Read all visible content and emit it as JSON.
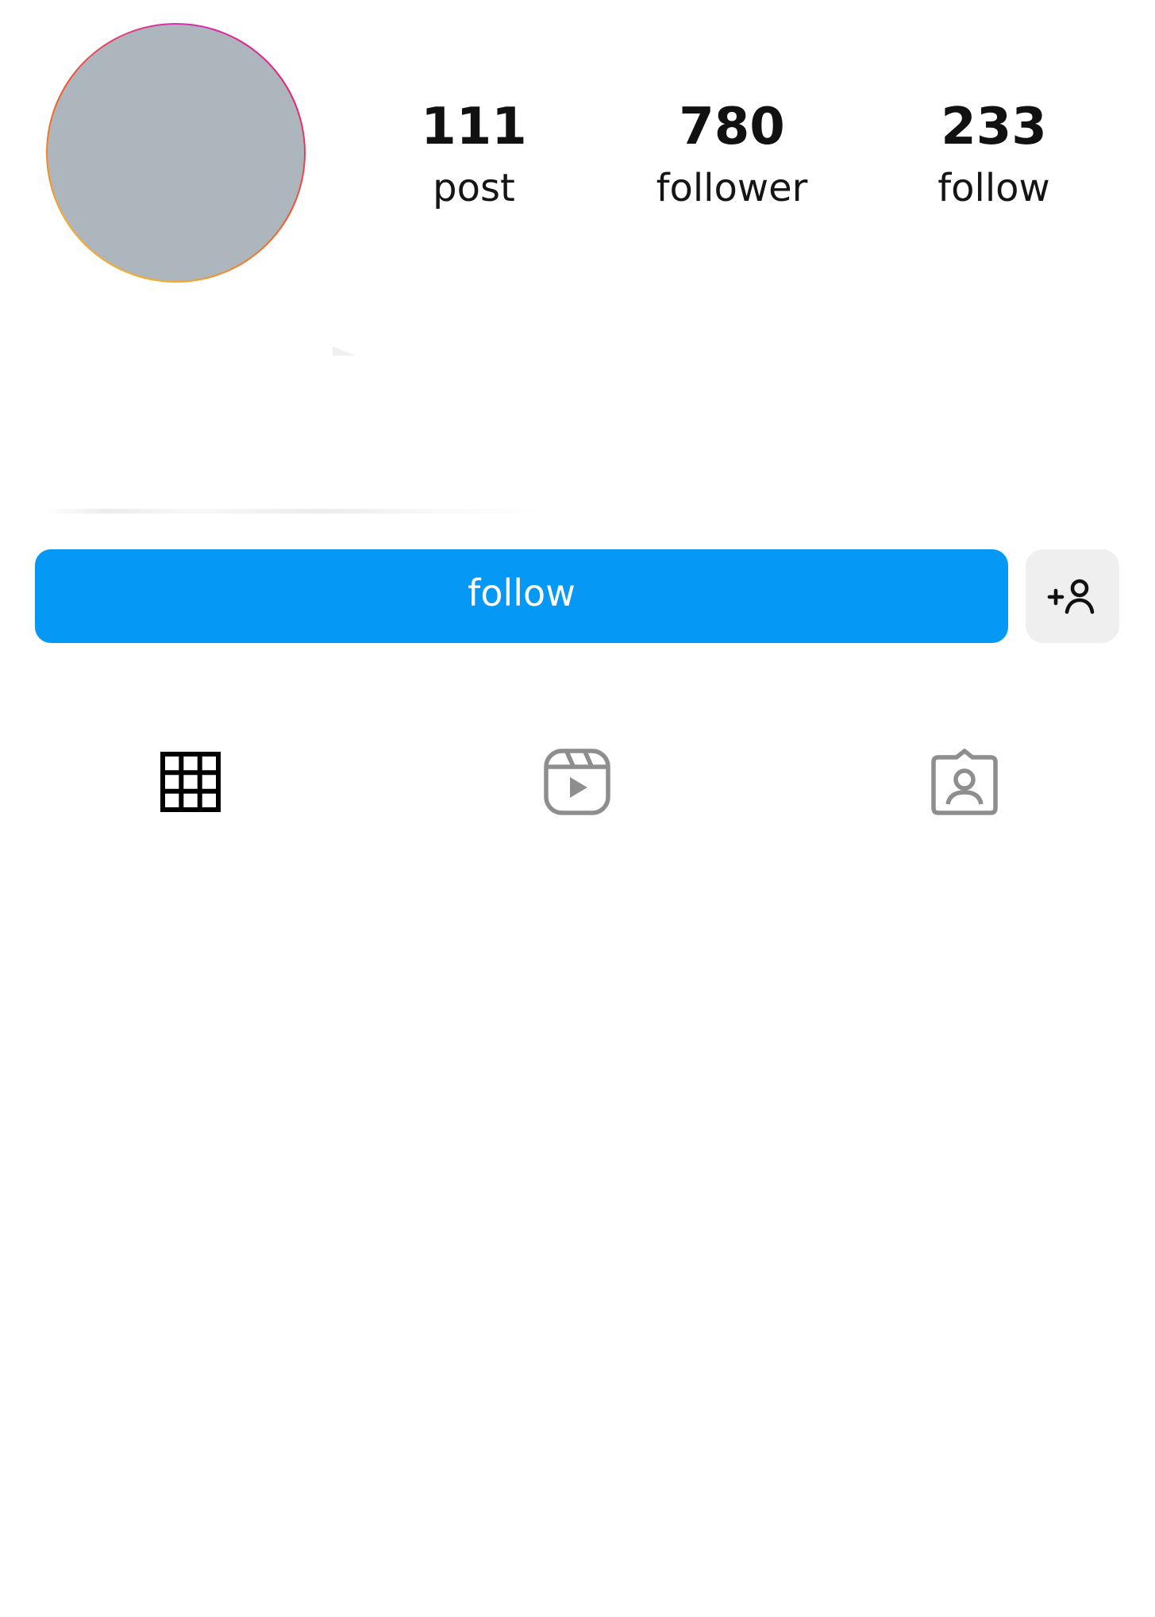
{
  "profile": {
    "stats": [
      {
        "count": "111",
        "label": "post"
      },
      {
        "count": "780",
        "label": "follower"
      },
      {
        "count": "233",
        "label": "follow"
      }
    ]
  },
  "actions": {
    "follow_label": "follow",
    "suggest_icon": "add-person-icon"
  },
  "tabs": [
    {
      "icon": "grid-icon",
      "active": true
    },
    {
      "icon": "reels-icon",
      "active": false
    },
    {
      "icon": "tagged-icon",
      "active": false
    }
  ],
  "colors": {
    "follow_button": "#0598f5",
    "avatar_placeholder": "#adb6bd",
    "tab_active": "#000000",
    "tab_inactive": "#8e8e8e",
    "secondary_button": "#efefef"
  }
}
